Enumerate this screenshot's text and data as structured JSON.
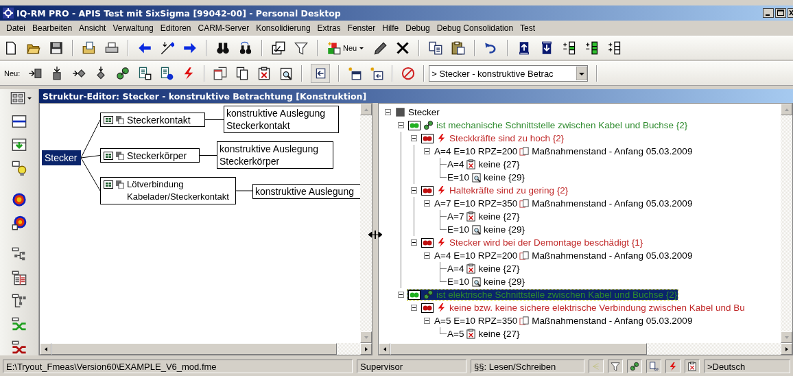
{
  "window": {
    "title": "IQ-RM PRO - APIS Test mit SixSigma [99042-00] - Personal Desktop"
  },
  "menu": [
    "Datei",
    "Bearbeiten",
    "Ansicht",
    "Verwaltung",
    "Editoren",
    "CARM-Server",
    "Konsolidierung",
    "Extras",
    "Fenster",
    "Hilfe",
    "Debug",
    "Debug Consolidation",
    "Test"
  ],
  "toolbar": {
    "new_button": "Neu",
    "new_label": "Neu:",
    "combo_value": "> Stecker - konstruktive Betrac"
  },
  "editor": {
    "title": "Struktur-Editor: Stecker - konstruktive Betrachtung [Konstruktion]",
    "structure": {
      "root": {
        "label": "Stecker",
        "selected": true
      },
      "children": [
        {
          "label": "Steckerkontakt",
          "selected": false,
          "description": "konstruktive Auslegung Steckerkontakt"
        },
        {
          "label": "Steckerkörper",
          "selected": false,
          "description": "konstruktive Auslegung Steckerkörper"
        },
        {
          "label": "Lötverbindung Kabelader/Steckerkontakt",
          "selected": false,
          "description": "konstruktive Auslegung"
        }
      ]
    },
    "tree": {
      "kind": "component",
      "label": "Stecker",
      "selected": false,
      "expanded": true,
      "children": [
        {
          "kind": "function",
          "label": "ist mechanische Schnittstelle zwischen Kabel und Buchse {2}",
          "selected": false,
          "expanded": true,
          "children": [
            {
              "kind": "failure",
              "label": "Steckkräfte sind zu hoch {2}",
              "selected": false,
              "expanded": true,
              "children": [
                {
                  "kind": "rating",
                  "label": "A=4 E=10 RPZ=200",
                  "measure": "Maßnahmenstand - Anfang 05.03.2009",
                  "selected": false,
                  "expanded": true,
                  "children": [
                    {
                      "kind": "avoidance",
                      "label": "A=4",
                      "action": "keine {27}",
                      "selected": false
                    },
                    {
                      "kind": "detection",
                      "label": "E=10",
                      "action": "keine {29}",
                      "selected": false
                    }
                  ]
                }
              ]
            },
            {
              "kind": "failure",
              "label": "Haltekräfte sind zu gering {2}",
              "selected": false,
              "expanded": true,
              "children": [
                {
                  "kind": "rating",
                  "label": "A=7 E=10 RPZ=350",
                  "measure": "Maßnahmenstand - Anfang 05.03.2009",
                  "selected": false,
                  "expanded": true,
                  "children": [
                    {
                      "kind": "avoidance",
                      "label": "A=7",
                      "action": "keine {27}",
                      "selected": false
                    },
                    {
                      "kind": "detection",
                      "label": "E=10",
                      "action": "keine {29}",
                      "selected": false
                    }
                  ]
                }
              ]
            },
            {
              "kind": "failure",
              "label": "Stecker wird bei der Demontage beschädigt {1}",
              "selected": false,
              "expanded": true,
              "children": [
                {
                  "kind": "rating",
                  "label": "A=4 E=10 RPZ=200",
                  "measure": "Maßnahmenstand - Anfang 05.03.2009",
                  "selected": false,
                  "expanded": true,
                  "children": [
                    {
                      "kind": "avoidance",
                      "label": "A=4",
                      "action": "keine {27}",
                      "selected": false
                    },
                    {
                      "kind": "detection",
                      "label": "E=10",
                      "action": "keine {29}",
                      "selected": false
                    }
                  ]
                }
              ]
            }
          ]
        },
        {
          "kind": "function",
          "label": "ist elektrische Schnittstelle zwischen Kabel und Buchse {2}",
          "selected": true,
          "expanded": true,
          "children": [
            {
              "kind": "failure",
              "label": "keine bzw. keine sichere elektrische Verbindung zwischen Kabel und Bu",
              "selected": false,
              "expanded": true,
              "children": [
                {
                  "kind": "rating",
                  "label": "A=5 E=10 RPZ=350",
                  "measure": "Maßnahmenstand - Anfang 05.03.2009",
                  "selected": false,
                  "expanded": true,
                  "children": [
                    {
                      "kind": "avoidance",
                      "label": "A=5",
                      "action": "keine {27}",
                      "selected": false
                    }
                  ]
                }
              ]
            }
          ]
        }
      ]
    }
  },
  "status_bar": {
    "path": "E:\\Tryout_Fmeas\\Version60\\EXAMPLE_V6_mod.fme",
    "user": "Supervisor",
    "rights": "§§: Lesen/Schreiben",
    "language": ">Deutsch"
  }
}
